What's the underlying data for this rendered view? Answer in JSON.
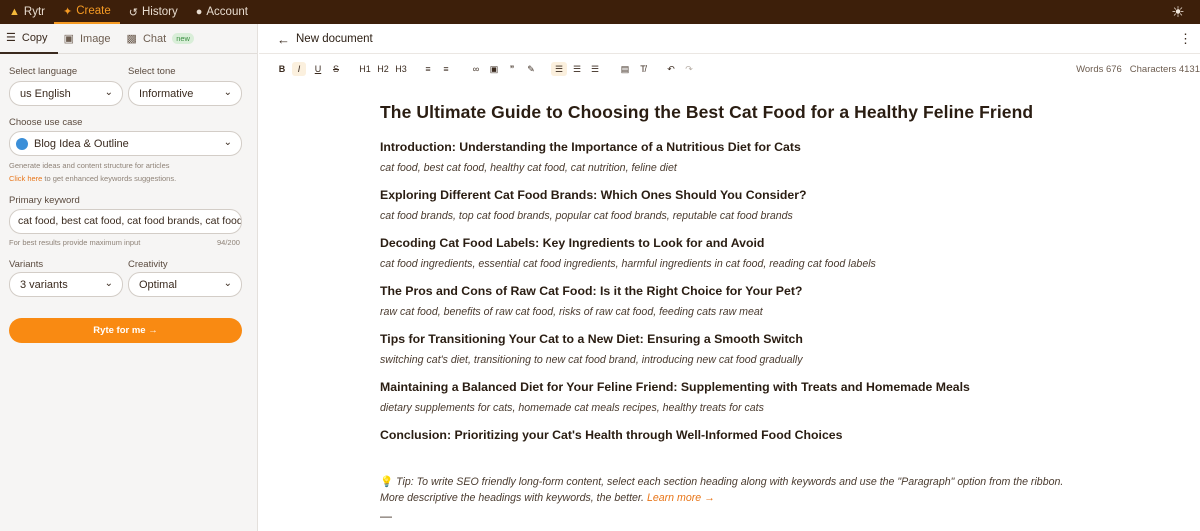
{
  "nav": {
    "items": [
      {
        "label": "Rytr",
        "icon": "rytr-logo-icon"
      },
      {
        "label": "Create",
        "icon": "sparkle-icon"
      },
      {
        "label": "History",
        "icon": "history-icon"
      },
      {
        "label": "Account",
        "icon": "user-icon"
      }
    ],
    "theme_icon": "sun-icon"
  },
  "sidebar": {
    "tabs": [
      {
        "label": "Copy",
        "icon": "lines-icon"
      },
      {
        "label": "Image",
        "icon": "image-icon"
      },
      {
        "label": "Chat",
        "icon": "chat-icon",
        "badge": "new"
      }
    ],
    "language": {
      "label": "Select language",
      "value": "us English"
    },
    "tone": {
      "label": "Select tone",
      "value": "Informative"
    },
    "use_case": {
      "label": "Choose use case",
      "value": "Blog Idea & Outline",
      "helper": "Generate ideas and content structure for articles",
      "link_text": "Click here",
      "link_suffix": " to get enhanced keywords suggestions."
    },
    "keyword": {
      "label": "Primary keyword",
      "value": "cat food, best cat food, cat food brands, cat food",
      "helper": "For best results provide maximum input",
      "count": "94/200"
    },
    "variants": {
      "label": "Variants",
      "value": "3 variants"
    },
    "creativity": {
      "label": "Creativity",
      "value": "Optimal"
    },
    "ryte_button": "Ryte for me →"
  },
  "editor": {
    "title": "New document",
    "words": "Words 676",
    "characters": "Characters 4131",
    "toolbar": [
      "B",
      "I",
      "U",
      "S",
      "H1",
      "H2",
      "H3"
    ]
  },
  "document": {
    "heading": "The Ultimate Guide to Choosing the Best Cat Food for a Healthy Feline Friend",
    "sections": [
      {
        "title": "Introduction: Understanding the Importance of a Nutritious Diet for Cats",
        "keywords": "cat food, best cat food, healthy cat food, cat nutrition, feline diet"
      },
      {
        "title": "Exploring Different Cat Food Brands: Which Ones Should You Consider?",
        "keywords": "cat food brands, top cat food brands, popular cat food brands, reputable cat food brands"
      },
      {
        "title": "Decoding Cat Food Labels: Key Ingredients to Look for and Avoid",
        "keywords": "cat food ingredients, essential cat food ingredients, harmful ingredients in cat food, reading cat food labels"
      },
      {
        "title": "The Pros and Cons of Raw Cat Food: Is it the Right Choice for Your Pet?",
        "keywords": "raw cat food, benefits of raw cat food, risks of raw cat food, feeding cats raw meat"
      },
      {
        "title": "Tips for Transitioning Your Cat to a New Diet: Ensuring a Smooth Switch",
        "keywords": "switching cat's diet, transitioning to new cat food brand, introducing new cat food gradually"
      },
      {
        "title": "Maintaining a Balanced Diet for Your Feline Friend: Supplementing with Treats and Homemade Meals",
        "keywords": "dietary supplements for cats, homemade cat meals recipes, healthy treats for cats"
      },
      {
        "title": "Conclusion: Prioritizing your Cat's Health through Well-Informed Food Choices",
        "keywords": ""
      }
    ],
    "tip": "Tip: To write SEO friendly long-form content, select each section heading along with keywords and use the \"Paragraph\" option from the ribbon. More descriptive the headings with keywords, the better.",
    "learn_more": "Learn more →",
    "dash": "—"
  }
}
